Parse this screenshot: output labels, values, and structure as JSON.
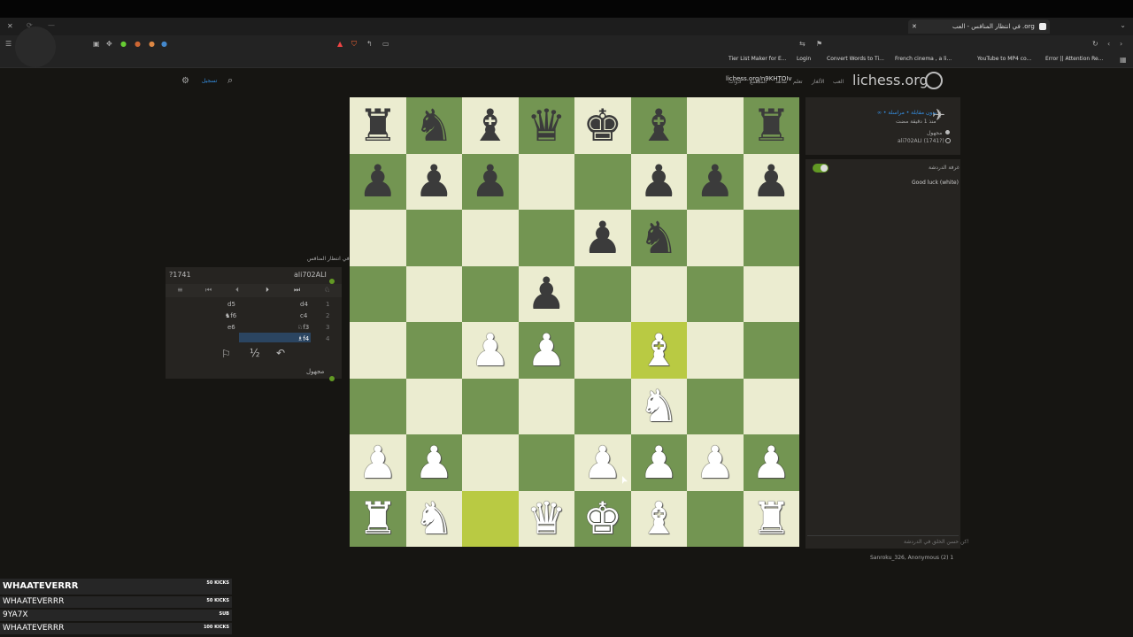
{
  "browser": {
    "tab_title": "في انتظار المنافس - العب .org",
    "url": "lichess.org/n9KHTOIv",
    "bookmarks": [
      "Tier List Maker for E...",
      "Login",
      "Convert Words to Ti...",
      "French cinema , a li...",
      "YouTube to MP4 co...",
      "Error || Attention Re..."
    ]
  },
  "site": {
    "logo": "lichess.org",
    "nav": [
      "العب",
      "الألغاز",
      "تعلم",
      "شاهد",
      "المجتمع",
      "أدوات"
    ],
    "signin": "تسجيل"
  },
  "board": {
    "rows": [
      [
        "r",
        "n",
        "b",
        "q",
        "k",
        "b",
        "",
        "r"
      ],
      [
        "p",
        "p",
        "p",
        "",
        "",
        "p",
        "p",
        "p"
      ],
      [
        "",
        "",
        "",
        "",
        "p",
        "n",
        "",
        ""
      ],
      [
        "",
        "",
        "",
        "p",
        "",
        "",
        "",
        ""
      ],
      [
        "",
        "",
        "P",
        "P",
        "",
        "B",
        "",
        ""
      ],
      [
        "",
        "",
        "",
        "",
        "",
        "N",
        "",
        ""
      ],
      [
        "P",
        "P",
        "",
        "",
        "P",
        "P",
        "P",
        "P"
      ],
      [
        "R",
        "N",
        "",
        "Q",
        "K",
        "B",
        "",
        "R"
      ]
    ],
    "highlight": [
      [
        4,
        5
      ],
      [
        7,
        2
      ]
    ]
  },
  "move_panel": {
    "title": "في انتظار المنافس",
    "opponent_rating": "?1741",
    "opponent_name": "ali702ALI",
    "player_name": "مجهول",
    "moves": [
      {
        "no": "1",
        "white": "d4",
        "black": "d5"
      },
      {
        "no": "2",
        "white": "c4",
        "black": "♞f6"
      },
      {
        "no": "3",
        "white": "♘f3",
        "black": "e6"
      },
      {
        "no": "4",
        "white": "♗f4",
        "black": ""
      }
    ],
    "actions": [
      "⚐",
      "½",
      "↶"
    ]
  },
  "info": {
    "game_type": "∞ • بدون مقابلة • مراسلة",
    "time": "منذ 1 دقيقة مضت",
    "player1": "مجهول",
    "player2": "ali702ALI (1741?)",
    "chat_title": "غرفة الدردشة",
    "chat_message": "Good luck (white)",
    "chat_placeholder": "كن حسن الخلق في الدردشة!",
    "spectators": "Sanroku_326, Anonymous (2)  1"
  },
  "overlay": [
    {
      "name": "WHAATEVERRR",
      "tag": "50 KICKS"
    },
    {
      "name": "WHAATEVERRR",
      "tag": "50 KICKS"
    },
    {
      "name": "9YA7X",
      "tag": "SUB"
    },
    {
      "name": "WHAATEVERRR",
      "tag": "100 KICKS"
    }
  ]
}
